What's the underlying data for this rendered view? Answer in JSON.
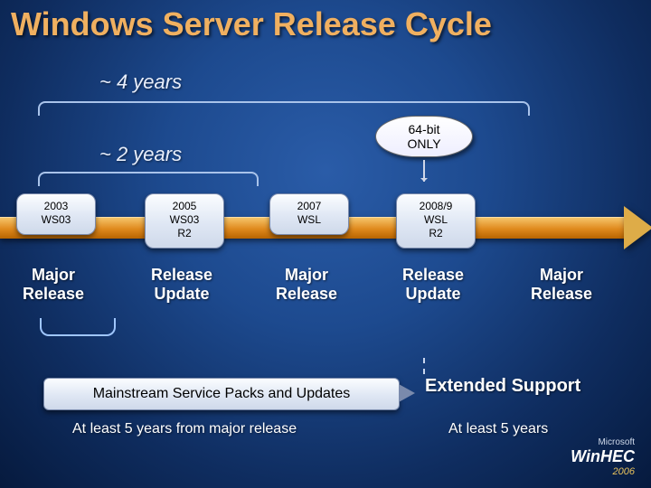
{
  "title": "Windows Server Release Cycle",
  "spans": {
    "four": "~ 4 years",
    "two": "~ 2 years"
  },
  "callout": {
    "line1": "64-bit",
    "line2": "ONLY"
  },
  "markers": [
    {
      "year": "2003",
      "name": "WS03",
      "extra": ""
    },
    {
      "year": "2005",
      "name": "WS03",
      "extra": "R2"
    },
    {
      "year": "2007",
      "name": "WSL",
      "extra": ""
    },
    {
      "year": "2008/9",
      "name": "WSL",
      "extra": "R2"
    },
    {
      "year": "",
      "name": "",
      "extra": ""
    }
  ],
  "release_labels": [
    "Major\nRelease",
    "Release\nUpdate",
    "Major\nRelease",
    "Release\nUpdate",
    "Major\nRelease"
  ],
  "support": {
    "mainstream": "Mainstream Service Packs and Updates",
    "extended": "Extended Support",
    "sub1": "At least 5 years from major release",
    "sub2": "At least 5 years"
  },
  "logo": {
    "ms": "Microsoft",
    "win": "WinHEC",
    "year": "2006"
  }
}
